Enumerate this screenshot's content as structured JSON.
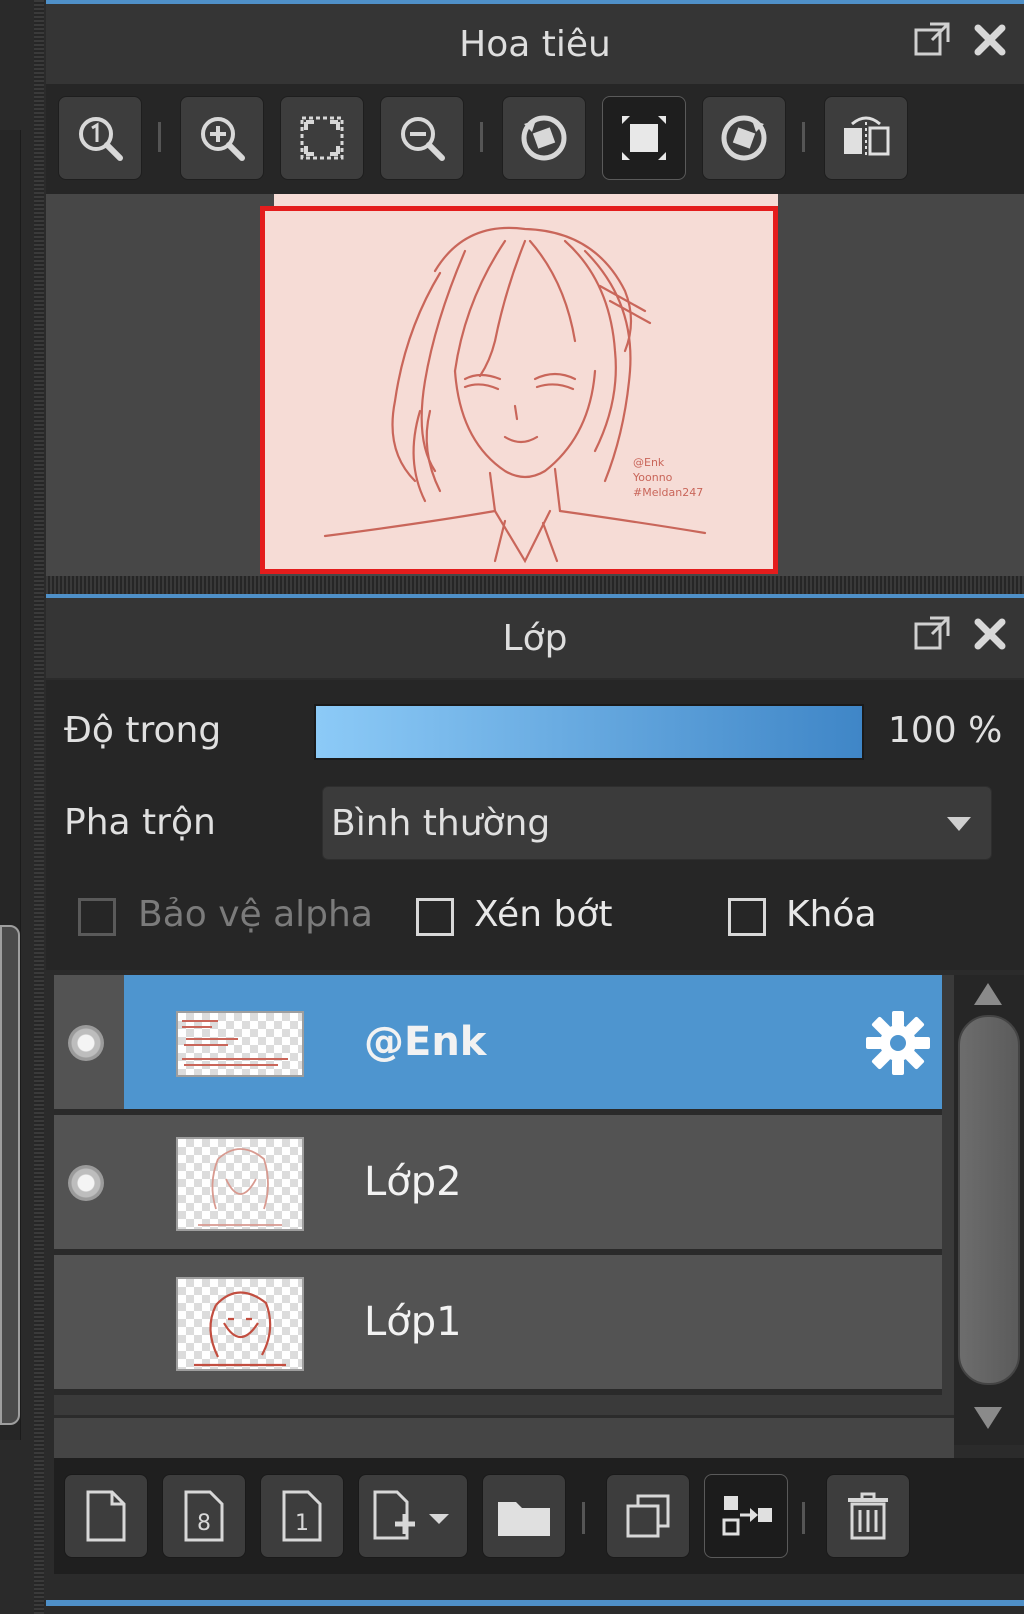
{
  "navigator": {
    "title": "Hoa tiêu",
    "tools": [
      {
        "icon": "zoom-actual-icon"
      },
      {
        "icon": "zoom-in-icon"
      },
      {
        "icon": "fit-window-icon"
      },
      {
        "icon": "zoom-out-icon"
      },
      {
        "icon": "rotate-left-icon"
      },
      {
        "icon": "fit-canvas-icon"
      },
      {
        "icon": "rotate-right-icon"
      },
      {
        "icon": "flip-horizontal-icon"
      }
    ],
    "canvas_watermark": [
      "@Enk",
      "Yoonno",
      "#Meldan247"
    ]
  },
  "layers_panel": {
    "title": "Lớp",
    "opacity_label": "Độ trong",
    "opacity_value": "100 %",
    "opacity_fraction": 1.0,
    "blend_label": "Pha trộn",
    "blend_value": "Bình thường",
    "options": {
      "protect_alpha": "Bảo vệ alpha",
      "clipping": "Xén bớt",
      "lock": "Khóa"
    },
    "layers": [
      {
        "name": "@Enk",
        "visible": true,
        "selected": true
      },
      {
        "name": "Lớp2",
        "visible": true,
        "selected": false
      },
      {
        "name": "Lớp1",
        "visible": false,
        "selected": false
      }
    ]
  },
  "colors": {
    "accent": "#4e95cf",
    "selection_frame": "#e41c1c",
    "sketch_line": "#c9665a",
    "canvas_bg": "#f6dcd6"
  }
}
